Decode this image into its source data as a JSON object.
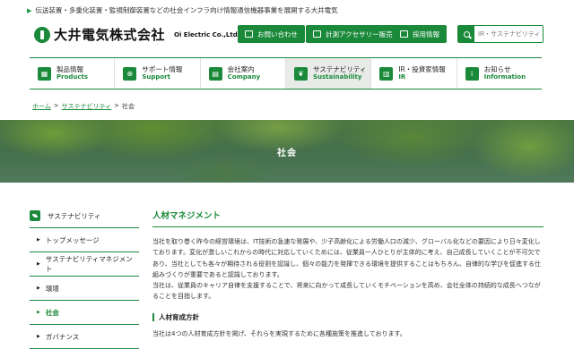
{
  "header": {
    "tagline": "伝送装置・多重化装置・監視制御装置などの社会インフラ向け情報通信機器事業を展開する大井電気",
    "logo_ja": "大井電気株式会社",
    "logo_en": "Oi Electric Co.,Ltd.",
    "buttons": [
      {
        "label": "お問い合わせ",
        "icon": "mail-icon"
      },
      {
        "label": "計測アクセサリー販売",
        "icon": "cart-icon"
      },
      {
        "label": "採用情報",
        "icon": "people-icon"
      }
    ],
    "search_placeholder": "IR・サステナビリティ"
  },
  "nav": [
    {
      "ja": "製品情報",
      "en": "Products",
      "icon": "grid-icon"
    },
    {
      "ja": "サポート情報",
      "en": "Support",
      "icon": "support-icon"
    },
    {
      "ja": "会社案内",
      "en": "Company",
      "icon": "building-icon"
    },
    {
      "ja": "サステナビリティ",
      "en": "Sustainability",
      "icon": "leaf-icon"
    },
    {
      "ja": "IR・投資家情報",
      "en": "IR",
      "icon": "document-icon"
    },
    {
      "ja": "お知らせ",
      "en": "Information",
      "icon": "info-icon"
    }
  ],
  "breadcrumb": {
    "home": "ホーム",
    "sep": ">",
    "parent": "サステナビリティ",
    "current": "社会"
  },
  "hero": {
    "title": "社会"
  },
  "sidebar": {
    "heading": "サステナビリティ",
    "items": [
      {
        "label": "トップメッセージ"
      },
      {
        "label": "サステナビリティマネジメント"
      },
      {
        "label": "環境"
      },
      {
        "label": "社会"
      },
      {
        "label": "ガバナンス"
      }
    ]
  },
  "main": {
    "title": "人材マネジメント",
    "paragraph1": "当社を取り巻く昨今の経営環境は、IT技術の急速な発展や、少子高齢化による労働人口の減少、グローバル化などの要因により日々変化しております。変化が激しいこれからの時代に対応していくためには、従業員一人ひとりが主体的に考え、自己成長していくことが不可欠であり、当社としても各々が期待される役割を認識し、個々の能力を発揮できる環境を提供することはもちろん、自律的な学びを促進する仕組みづくりが重要であると認識しております。",
    "paragraph2": "当社は、従業員のキャリア自律を支援することで、将来に向かって成長していくモチベーションを高め、会社全体の持続的な成長へつながることを目指します。",
    "subheading": "人材育成方針",
    "paragraph3": "当社は4つの人材育成方針を掲げ、それらを実現するために各種施策を推進しております。"
  },
  "colors": {
    "brand": "#1a8a3a"
  }
}
